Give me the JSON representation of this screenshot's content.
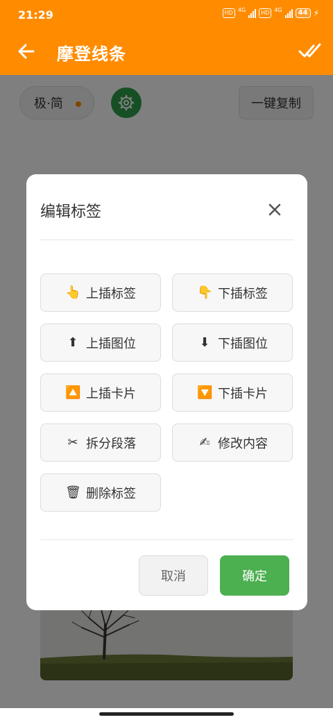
{
  "status_bar": {
    "time": "21:29",
    "hd1": "HD",
    "net1": "4G",
    "hd2": "HD",
    "net2": "4G",
    "battery": "44"
  },
  "header": {
    "title": "摩登线条",
    "back_icon": "arrow-left-icon",
    "confirm_icon": "double-check-icon"
  },
  "toolbar": {
    "style_chip": "极·简",
    "settings_icon": "gear-icon",
    "copy_button": "一键复制"
  },
  "dialog": {
    "title": "编辑标签",
    "close_icon": "close-icon",
    "actions": [
      {
        "emoji": "👆",
        "label": "上插标签"
      },
      {
        "emoji": "👇",
        "label": "下插标签"
      },
      {
        "emoji": "⬆",
        "label": "上插图位"
      },
      {
        "emoji": "⬇",
        "label": "下插图位"
      },
      {
        "emoji": "🔼",
        "label": "上插卡片"
      },
      {
        "emoji": "🔽",
        "label": "下插卡片"
      },
      {
        "emoji": "✂",
        "label": "拆分段落"
      },
      {
        "emoji": "✍",
        "label": "修改内容"
      },
      {
        "emoji": "🗑",
        "label": "删除标签"
      }
    ],
    "cancel": "取消",
    "confirm": "确定"
  },
  "colors": {
    "header": "#ff8c00",
    "settings_button": "#2e9e48",
    "confirm_button": "#4caf50"
  }
}
